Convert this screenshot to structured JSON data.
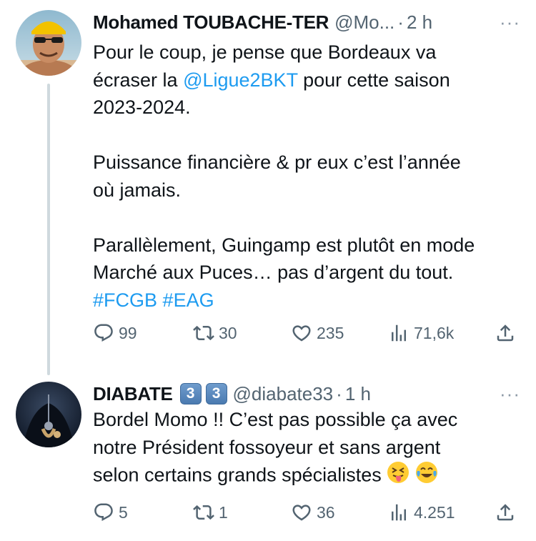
{
  "tweets": [
    {
      "name": "Mohamed TOUBACHE-TER",
      "handle": "@Mo...",
      "time": "2 h",
      "dot": "·",
      "more": "···",
      "text": {
        "line1_a": "Pour le coup, je pense que Bordeaux va",
        "line2_a": "écraser la ",
        "mention": "@Ligue2BKT",
        "line2_b": " pour cette saison",
        "line3": "2023-2024.",
        "para2_l1": "Puissance financière & pr eux c’est l’année",
        "para2_l2": "où jamais.",
        "para3_l1": "Parallèlement, Guingamp est plutôt en mode",
        "para3_l2": "Marché aux Puces… pas d’argent du tout.",
        "hashtag1": "#FCGB",
        "hashtag2": "#EAG"
      },
      "actions": {
        "replies": "99",
        "reposts": "30",
        "likes": "235",
        "views": "71,6k"
      }
    },
    {
      "name": "DIABATE",
      "badges": [
        "3",
        "3"
      ],
      "handle": "@diabate33",
      "time": "1 h",
      "dot": "·",
      "more": "···",
      "text": {
        "line1": "Bordel Momo !! C’est pas possible ça avec",
        "line2": "notre Président fossoyeur et sans argent",
        "line3": "selon certains grands spécialistes"
      },
      "emojis": [
        "squinting-face-with-tongue",
        "face-with-tears-of-joy"
      ],
      "actions": {
        "replies": "5",
        "reposts": "1",
        "likes": "36",
        "views": "4.251"
      }
    }
  ],
  "colors": {
    "link": "#1d9bf0",
    "text": "#0f1419",
    "muted": "#536471",
    "thread_line": "#cfd9de"
  }
}
